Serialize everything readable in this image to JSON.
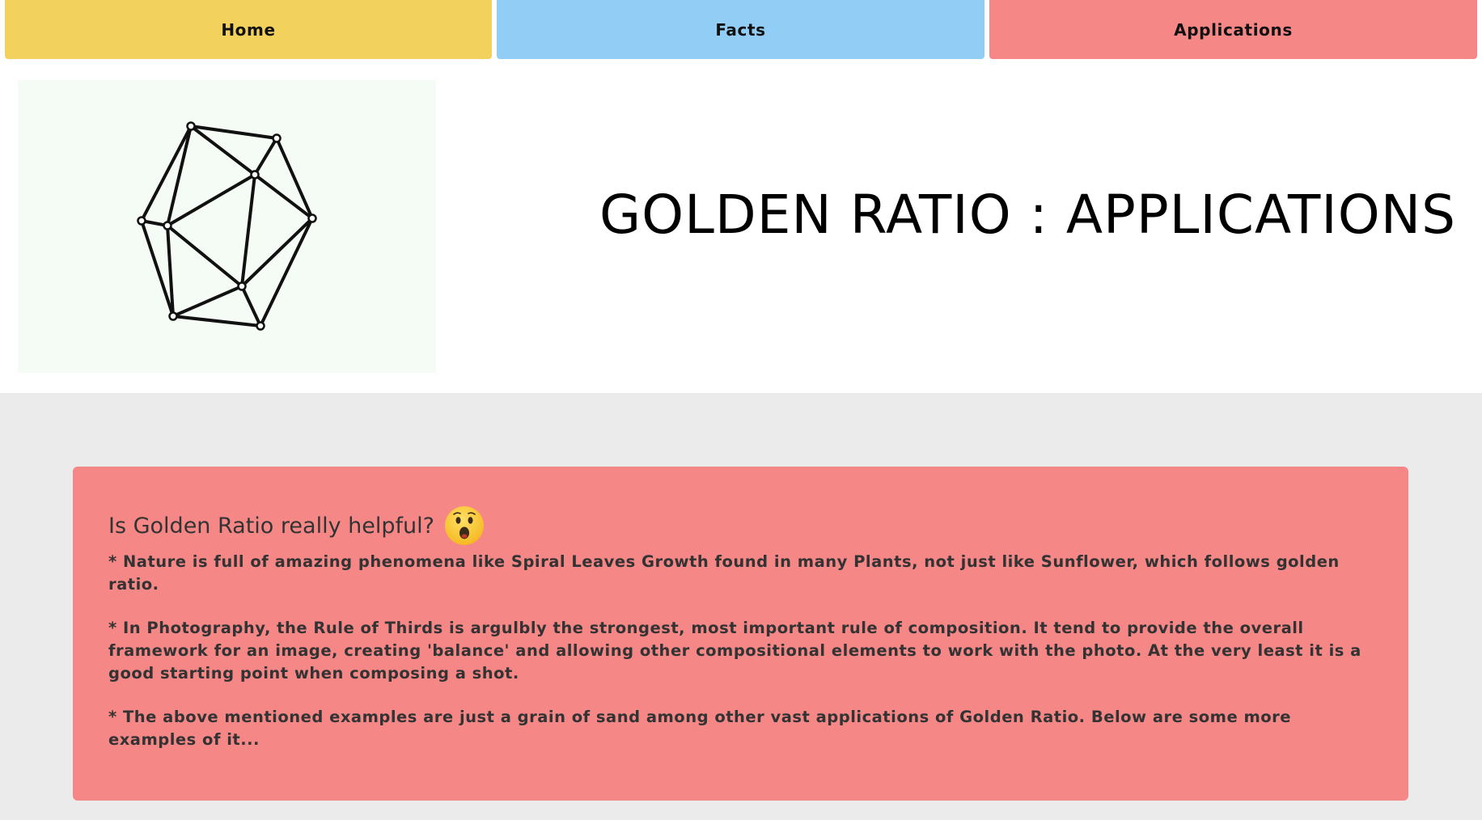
{
  "nav": {
    "home_label": "Home",
    "facts_label": "Facts",
    "applications_label": "Applications",
    "colors": {
      "home": "#f2d25c",
      "facts": "#92cdf5",
      "applications": "#f68787"
    }
  },
  "header": {
    "logo": "icosahedron-wireframe-icon",
    "title": "GOLDEN RATIO : APPLICATIONS"
  },
  "card": {
    "heading": "Is Golden Ratio really helpful?",
    "emoji": "astonished-face-icon",
    "paragraphs": [
      "* Nature is full of amazing phenomena like Spiral Leaves Growth found in many Plants, not just like Sunflower, which follows golden ratio.",
      "* In Photography, the Rule of Thirds is argulbly the strongest, most important rule of composition. It tend to provide the overall framework for an image, creating 'balance' and allowing other compositional elements to work with the photo. At the very least it is a good starting point when composing a shot.",
      "* The above mentioned examples are just a grain of sand among other vast applications of Golden Ratio. Below are some more examples of it..."
    ],
    "background": "#f68787"
  },
  "page_background": "#ebebeb"
}
